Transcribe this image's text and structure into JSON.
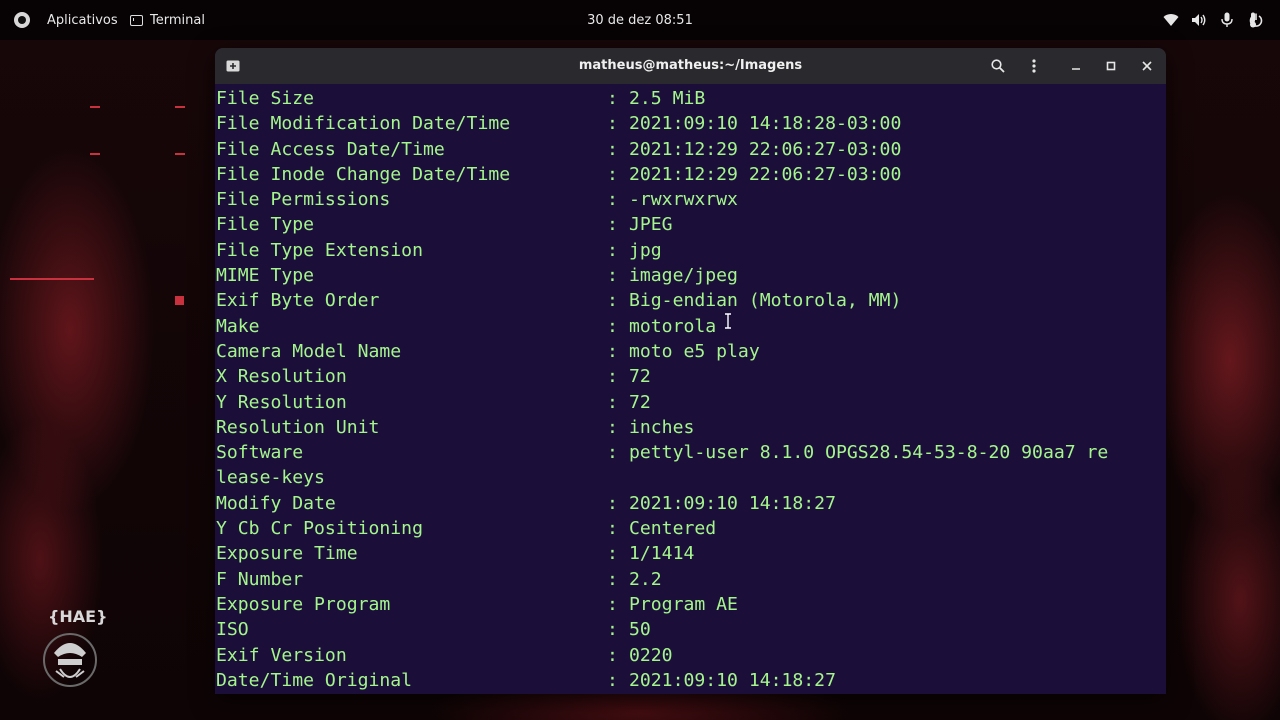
{
  "topbar": {
    "apps_label": "Aplicativos",
    "active_app": "Terminal",
    "clock": "30 de dez  08:51"
  },
  "window": {
    "title": "matheus@matheus:~/Imagens"
  },
  "terminal": {
    "lines": [
      {
        "key": "File Size",
        "sep": ":",
        "value": "2.5 MiB"
      },
      {
        "key": "File Modification Date/Time",
        "sep": ":",
        "value": "2021:09:10 14:18:28-03:00"
      },
      {
        "key": "File Access Date/Time",
        "sep": ":",
        "value": "2021:12:29 22:06:27-03:00"
      },
      {
        "key": "File Inode Change Date/Time",
        "sep": ":",
        "value": "2021:12:29 22:06:27-03:00"
      },
      {
        "key": "File Permissions",
        "sep": ":",
        "value": "-rwxrwxrwx"
      },
      {
        "key": "File Type",
        "sep": ":",
        "value": "JPEG"
      },
      {
        "key": "File Type Extension",
        "sep": ":",
        "value": "jpg"
      },
      {
        "key": "MIME Type",
        "sep": ":",
        "value": "image/jpeg"
      },
      {
        "key": "Exif Byte Order",
        "sep": ":",
        "value": "Big-endian (Motorola, MM)"
      },
      {
        "key": "Make",
        "sep": ":",
        "value": "motorola"
      },
      {
        "key": "Camera Model Name",
        "sep": ":",
        "value": "moto e5 play"
      },
      {
        "key": "X Resolution",
        "sep": ":",
        "value": "72"
      },
      {
        "key": "Y Resolution",
        "sep": ":",
        "value": "72"
      },
      {
        "key": "Resolution Unit",
        "sep": ":",
        "value": "inches"
      },
      {
        "key": "Software",
        "sep": ":",
        "value": "pettyl-user 8.1.0 OPGS28.54-53-8-20 90aa7 re"
      },
      {
        "key": "lease-keys",
        "sep": "",
        "value": ""
      },
      {
        "key": "Modify Date",
        "sep": ":",
        "value": "2021:09:10 14:18:27"
      },
      {
        "key": "Y Cb Cr Positioning",
        "sep": ":",
        "value": "Centered"
      },
      {
        "key": "Exposure Time",
        "sep": ":",
        "value": "1/1414"
      },
      {
        "key": "F Number",
        "sep": ":",
        "value": "2.2"
      },
      {
        "key": "Exposure Program",
        "sep": ":",
        "value": "Program AE"
      },
      {
        "key": "ISO",
        "sep": ":",
        "value": "50"
      },
      {
        "key": "Exif Version",
        "sep": ":",
        "value": "0220"
      },
      {
        "key": "Date/Time Original",
        "sep": ":",
        "value": "2021:09:10 14:18:27"
      }
    ]
  },
  "desktop": {
    "logo_text": "{HAE}"
  },
  "colors": {
    "terminal_bg": "#1b0f3a",
    "terminal_fg": "#a4f58c",
    "titlebar_bg": "#2a2a2e",
    "accent_red": "#c8313d"
  }
}
